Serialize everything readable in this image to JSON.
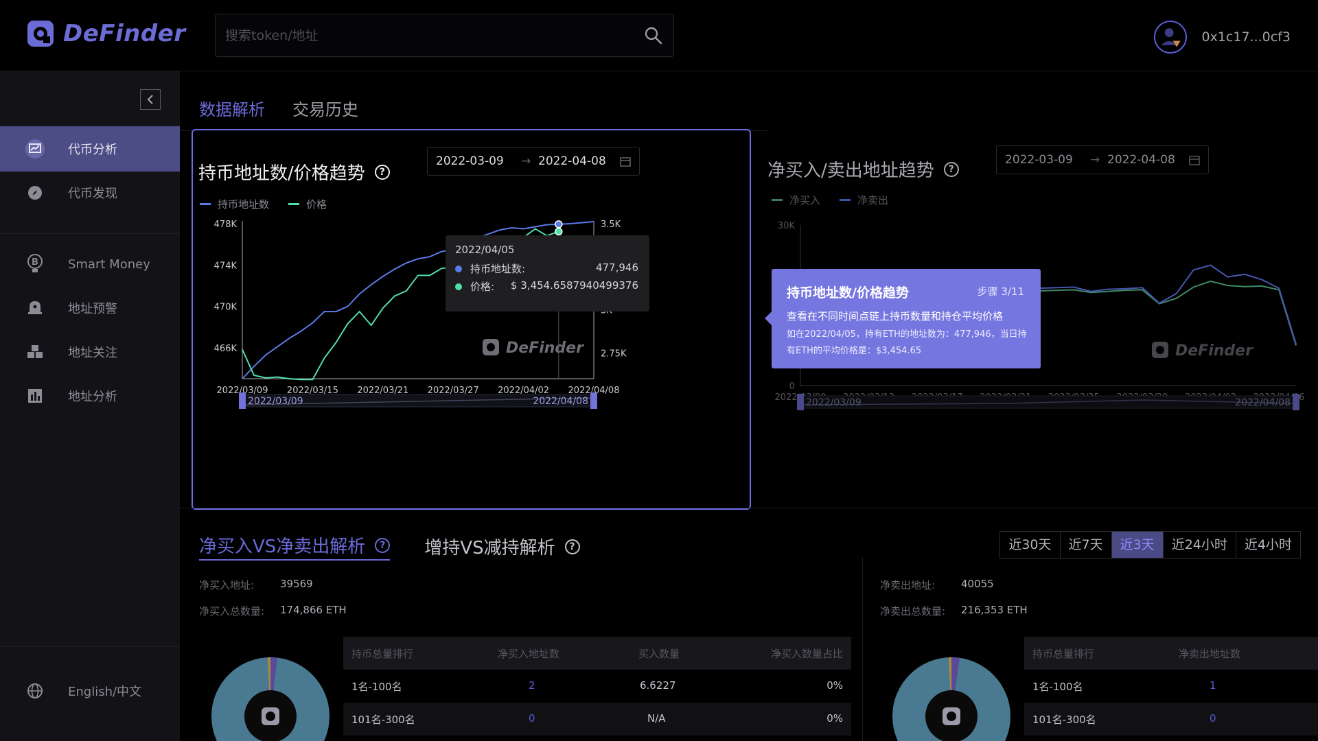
{
  "brand": {
    "name": "DeFinder"
  },
  "search": {
    "placeholder": "搜索token/地址"
  },
  "user": {
    "address": "0x1c17...0cf3"
  },
  "sidebar": {
    "items": [
      {
        "label": "代币分析",
        "icon": "chart-icon",
        "active": true
      },
      {
        "label": "代币发现",
        "icon": "compass-icon"
      },
      {
        "label": "Smart Money",
        "icon": "bulb-bitcoin-icon"
      },
      {
        "label": "地址预警",
        "icon": "bell-icon"
      },
      {
        "label": "地址关注",
        "icon": "cubes-icon"
      },
      {
        "label": "地址分析",
        "icon": "bar-chart-icon"
      }
    ],
    "language": "English/中文"
  },
  "tabs": [
    "数据解析",
    "交易历史"
  ],
  "left_panel": {
    "title": "持币地址数/价格趋势",
    "date_start": "2022-03-09",
    "date_end": "2022-04-08",
    "legend": [
      "持币地址数",
      "价格"
    ],
    "slider_start": "2022/03/09",
    "slider_end": "2022/04/08",
    "watermark": "DeFinder",
    "tooltip": {
      "date": "2022/04/05",
      "row1_label": "持币地址数:",
      "row1_value": "477,946",
      "row2_label": "价格:",
      "row2_value": "$ 3,454.6587940499376"
    }
  },
  "right_panel": {
    "title": "净买入/卖出地址趋势",
    "date_start": "2022-03-09",
    "date_end": "2022-04-08",
    "legend": [
      "净买入",
      "净卖出"
    ],
    "slider_start": "2022/03/09",
    "slider_end": "2022/04/08",
    "watermark": "DeFinder"
  },
  "guide": {
    "title": "持币地址数/价格趋势",
    "step": "步骤 3/11",
    "line1": "查看在不同时间点链上持币数量和持仓平均价格",
    "line2": "如在2022/04/05，持有ETH的地址数为：477,946，当日持有ETH的平均价格是：$3,454.65"
  },
  "section_tabs": [
    "净买入VS净卖出解析",
    "增持VS减持解析"
  ],
  "periods": [
    "近30天",
    "近7天",
    "近3天",
    "近24小时",
    "近4小时"
  ],
  "period_active": "近3天",
  "buy_stats": {
    "addr_label": "净买入地址:",
    "addr_value": "39569",
    "total_label": "净买入总数量:",
    "total_value": "174,866 ETH"
  },
  "sell_stats": {
    "addr_label": "净卖出地址:",
    "addr_value": "40055",
    "total_label": "净卖出总数量:",
    "total_value": "216,353 ETH"
  },
  "buy_table": {
    "headers": [
      "持币总量排行",
      "净买入地址数",
      "买入数量",
      "净买入数量占比"
    ],
    "rows": [
      [
        "1名-100名",
        "2",
        "6.6227",
        "0%"
      ],
      [
        "101名-300名",
        "0",
        "N/A",
        "0%"
      ]
    ]
  },
  "sell_table": {
    "headers": [
      "持币总量排行",
      "净卖出地址数"
    ],
    "rows": [
      [
        "1名-100名",
        "1"
      ],
      [
        "101名-300名",
        "0"
      ]
    ]
  },
  "colors": {
    "accent": "#6a6ad8",
    "holders_line": "#5b7be8",
    "price_line": "#4fe0a8",
    "pie": "#4a7a92"
  },
  "chart_data": [
    {
      "type": "line",
      "title": "持币地址数/价格趋势",
      "x": [
        "2022/03/09",
        "2022/03/10",
        "2022/03/11",
        "2022/03/12",
        "2022/03/13",
        "2022/03/14",
        "2022/03/15",
        "2022/03/16",
        "2022/03/17",
        "2022/03/18",
        "2022/03/19",
        "2022/03/20",
        "2022/03/21",
        "2022/03/22",
        "2022/03/23",
        "2022/03/24",
        "2022/03/25",
        "2022/03/26",
        "2022/03/27",
        "2022/03/28",
        "2022/03/29",
        "2022/03/30",
        "2022/03/31",
        "2022/04/01",
        "2022/04/02",
        "2022/04/03",
        "2022/04/04",
        "2022/04/05",
        "2022/04/06",
        "2022/04/07",
        "2022/04/08"
      ],
      "xticks": [
        "2022/03/09",
        "2022/03/15",
        "2022/03/21",
        "2022/03/27",
        "2022/04/02",
        "2022/04/08"
      ],
      "y_left_ticks": [
        "466K",
        "470K",
        "474K",
        "478K"
      ],
      "y_right_ticks": [
        "2.75K",
        "3K",
        "3.25K",
        "3.5K"
      ],
      "ylim_left": [
        463000,
        478000
      ],
      "ylim_right": [
        2600,
        3500
      ],
      "series": [
        {
          "name": "持币地址数",
          "axis": "left",
          "values": [
            463000,
            464200,
            465300,
            466100,
            466900,
            467600,
            468400,
            469500,
            469500,
            470000,
            471200,
            472100,
            472900,
            473600,
            474200,
            474600,
            474800,
            475300,
            475500,
            475900,
            476600,
            477000,
            477400,
            477600,
            477500,
            477700,
            477900,
            477946,
            478000,
            478100,
            478200
          ]
        },
        {
          "name": "价格",
          "axis": "right",
          "values": [
            2770,
            2620,
            2605,
            2610,
            2600,
            2595,
            2595,
            2720,
            2810,
            2920,
            2990,
            2910,
            3010,
            3080,
            3110,
            3200,
            3200,
            3240,
            3250,
            3280,
            3330,
            3350,
            3390,
            3360,
            3420,
            3470,
            3430,
            3454.66,
            3200,
            3150,
            3210
          ]
        }
      ]
    },
    {
      "type": "line",
      "title": "净买入/卖出地址趋势",
      "x": [
        "2022/03/09",
        "2022/03/10",
        "2022/03/11",
        "2022/03/12",
        "2022/03/13",
        "2022/03/14",
        "2022/03/15",
        "2022/03/16",
        "2022/03/17",
        "2022/03/18",
        "2022/03/19",
        "2022/03/20",
        "2022/03/21",
        "2022/03/22",
        "2022/03/23",
        "2022/03/24",
        "2022/03/25",
        "2022/03/26",
        "2022/03/27",
        "2022/03/28",
        "2022/03/29",
        "2022/03/30",
        "2022/03/31",
        "2022/04/01",
        "2022/04/02",
        "2022/04/03",
        "2022/04/04",
        "2022/04/05",
        "2022/04/06",
        "2022/04/07"
      ],
      "xticks": [
        "2022/03/09",
        "2022/03/13",
        "2022/03/17",
        "2022/03/21",
        "2022/03/25",
        "2022/03/29",
        "2022/04/02",
        "2022/04/06"
      ],
      "y_ticks": [
        "0",
        "30K"
      ],
      "ylim": [
        0,
        30000
      ],
      "series": [
        {
          "name": "净买入",
          "values": [
            17000,
            17200,
            17100,
            17300,
            17200,
            17400,
            17300,
            17500,
            17400,
            17600,
            17500,
            17700,
            17600,
            17800,
            17700,
            17800,
            17900,
            17400,
            17600,
            17800,
            17900,
            15300,
            16300,
            18400,
            19500,
            18700,
            18500,
            18600,
            17900,
            7500
          ]
        },
        {
          "name": "净卖出",
          "values": [
            17500,
            17700,
            17600,
            17800,
            17700,
            17900,
            17800,
            18000,
            17900,
            18100,
            18000,
            18200,
            18100,
            18300,
            18200,
            18300,
            18400,
            17600,
            18000,
            18100,
            18300,
            15400,
            17200,
            21600,
            22500,
            20300,
            20800,
            19800,
            18200,
            7800
          ]
        }
      ]
    }
  ]
}
